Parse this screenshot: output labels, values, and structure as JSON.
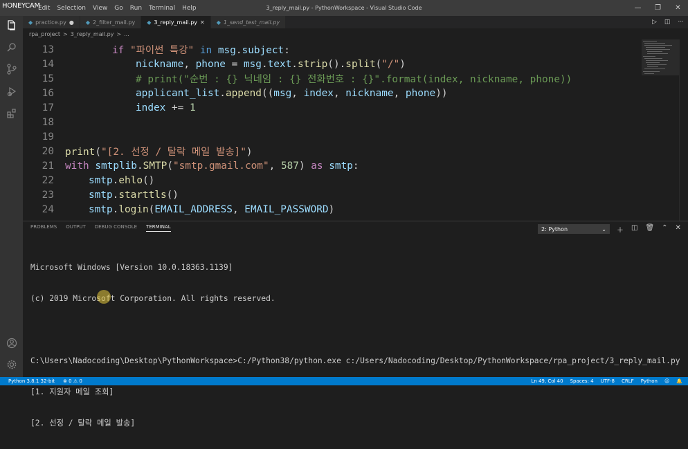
{
  "watermark": "HONEYCAM",
  "menu": [
    "Edit",
    "Selection",
    "View",
    "Go",
    "Run",
    "Terminal",
    "Help"
  ],
  "window_title": "3_reply_mail.py - PythonWorkspace - Visual Studio Code",
  "tabs": [
    {
      "label": "practice.py",
      "active": false,
      "italic": false
    },
    {
      "label": "2_filter_mail.py",
      "active": false,
      "italic": false
    },
    {
      "label": "3_reply_mail.py",
      "active": true,
      "italic": false
    },
    {
      "label": "1_send_test_mail.py",
      "active": false,
      "italic": true
    }
  ],
  "breadcrumb": [
    "rpa_project",
    ">",
    "3_reply_mail.py",
    ">",
    "..."
  ],
  "line_numbers": [
    "13",
    "14",
    "15",
    "16",
    "17",
    "18",
    "19",
    "20",
    "21",
    "22",
    "23",
    "24"
  ],
  "panel_tabs": [
    "PROBLEMS",
    "OUTPUT",
    "DEBUG CONSOLE",
    "TERMINAL"
  ],
  "terminal_select": "2: Python",
  "terminal_lines": [
    "Microsoft Windows [Version 10.0.18363.1139]",
    "(c) 2019 Microsoft Corporation. All rights reserved.",
    "",
    "C:\\Users\\Nadocoding\\Desktop\\PythonWorkspace>C:/Python38/python.exe c:/Users/Nadocoding/Desktop/PythonWorkspace/rpa_project/3_reply_mail.py",
    "[1. 지원자 메일 조회]",
    "[2. 선정 / 탈락 메일 발송]"
  ],
  "status": {
    "python": "Python 3.8.1 32-bit",
    "problems": "⊗ 0 ⚠ 0",
    "position": "Ln 49, Col 40",
    "spaces": "Spaces: 4",
    "encoding": "UTF-8",
    "eol": "CRLF",
    "language": "Python"
  }
}
